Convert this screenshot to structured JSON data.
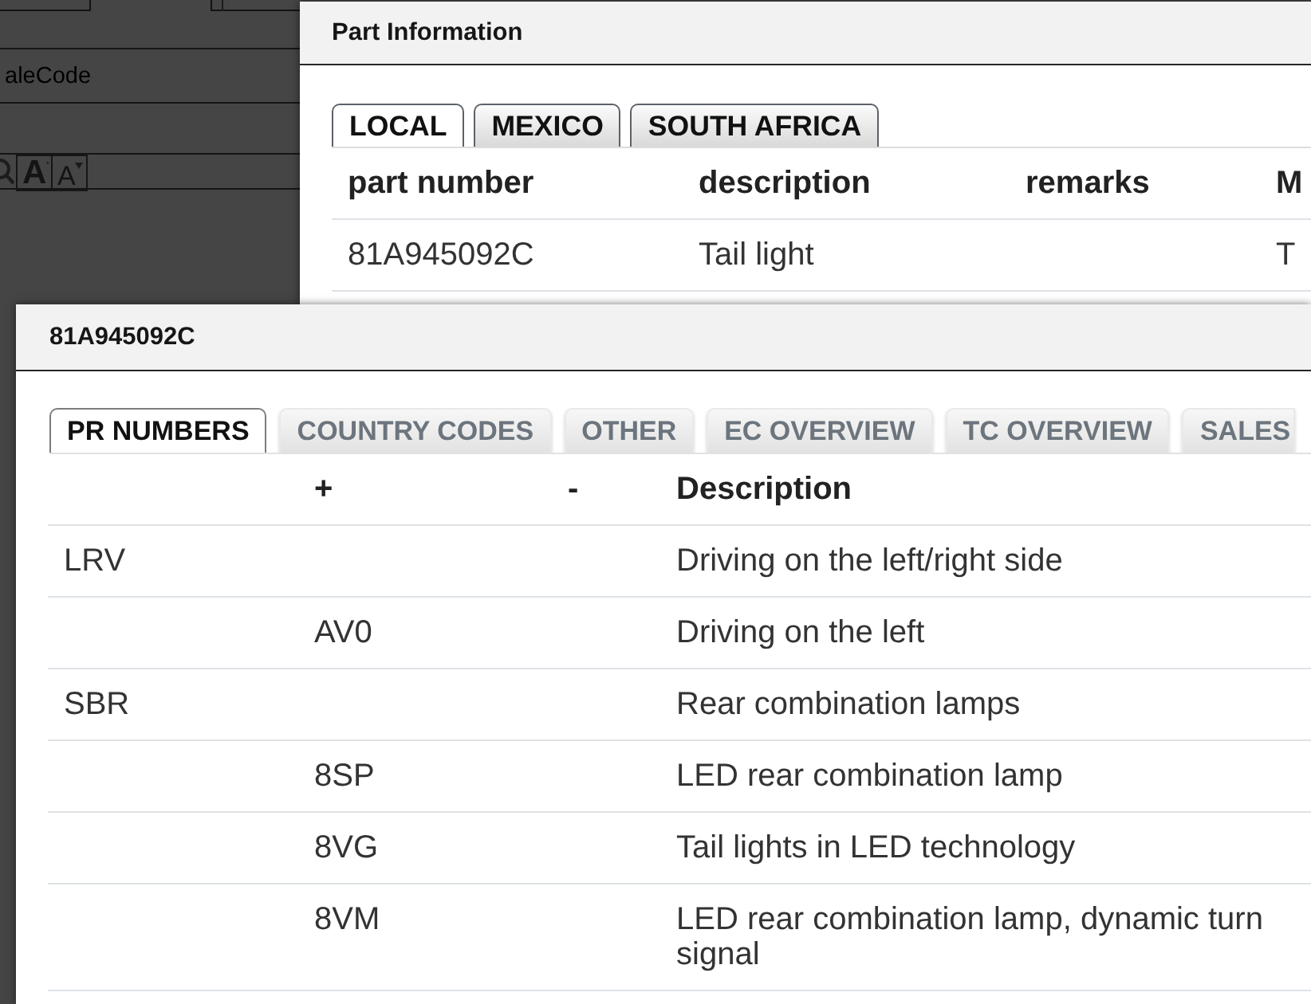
{
  "background_page": {
    "field_text": "aleCode",
    "font_buttons": [
      {
        "kind": "increase",
        "glyph": "A"
      },
      {
        "kind": "decrease",
        "glyph": "A"
      }
    ]
  },
  "part_information_dialog": {
    "title": "Part Information",
    "tabs": [
      {
        "label": "LOCAL",
        "selected": true
      },
      {
        "label": "MEXICO",
        "selected": false
      },
      {
        "label": "SOUTH AFRICA",
        "selected": false
      }
    ],
    "table": {
      "header": {
        "part_number": "part number",
        "description": "description",
        "remarks": "remarks",
        "column_4": "M"
      },
      "rows": [
        {
          "part_number": "81A945092C",
          "description": "Tail light",
          "column_4": "T"
        }
      ]
    }
  },
  "part_dialog": {
    "title": "81A945092C",
    "tabs": [
      {
        "label": "PR NUMBERS",
        "selected": true
      },
      {
        "label": "COUNTRY CODES",
        "selected": false
      },
      {
        "label": "OTHER",
        "selected": false
      },
      {
        "label": "EC OVERVIEW",
        "selected": false
      },
      {
        "label": "TC OVERVIEW",
        "selected": false
      },
      {
        "label": "SALES",
        "selected": false
      }
    ],
    "table": {
      "header": {
        "plus": "+",
        "minus": "-",
        "description": "Description"
      },
      "rows": [
        {
          "column_1": "LRV",
          "description": "Driving on the left/right side"
        },
        {
          "plus": "AV0",
          "description": "Driving on the left"
        },
        {
          "column_1": "SBR",
          "description": "Rear combination lamps"
        },
        {
          "plus": "8SP",
          "description": "LED rear combination lamp"
        },
        {
          "plus": "8VG",
          "description": "Tail lights in LED technology"
        },
        {
          "plus": "8VM",
          "description": "LED rear combination lamp, dynamic turn signal"
        }
      ]
    }
  }
}
